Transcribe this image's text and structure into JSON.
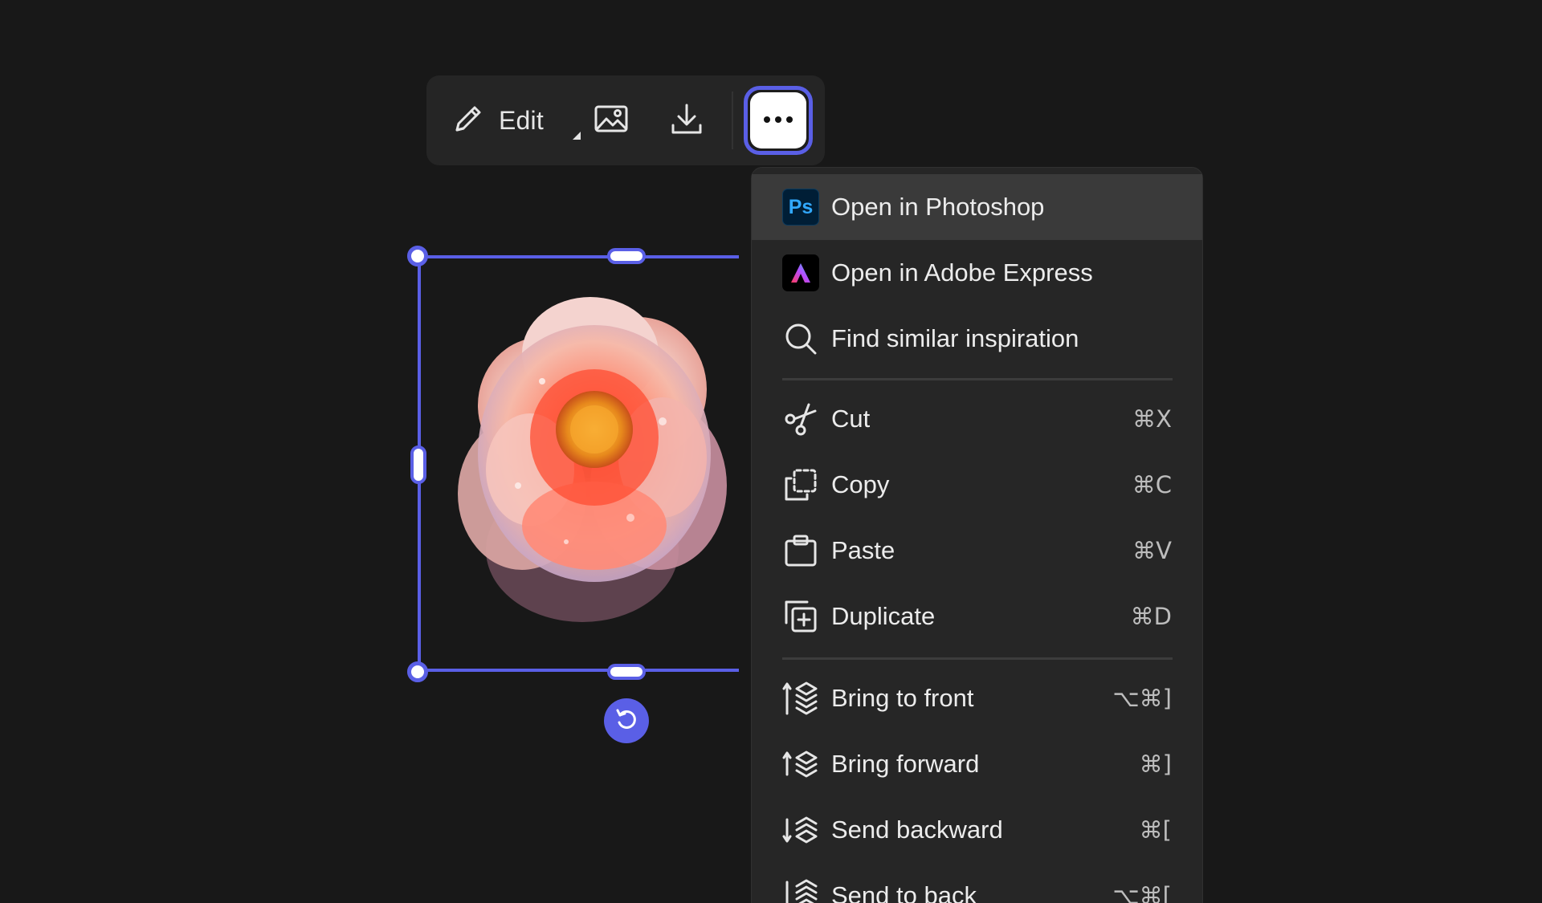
{
  "toolbar": {
    "edit_label": "Edit",
    "buttons": [
      {
        "name": "edit",
        "icon": "pencil-icon"
      },
      {
        "name": "image",
        "icon": "image-icon"
      },
      {
        "name": "download",
        "icon": "download-icon"
      },
      {
        "name": "more",
        "icon": "more-horizontal-icon"
      }
    ]
  },
  "canvas": {
    "selected_element": "flower-image",
    "accent_color": "#5a5fe6",
    "background_color": "#181818"
  },
  "menu": {
    "app_items": [
      {
        "label": "Open in Photoshop",
        "icon": "photoshop-icon",
        "badge": "Ps",
        "active": true
      },
      {
        "label": "Open in Adobe Express",
        "icon": "adobe-express-icon"
      },
      {
        "label": "Find similar inspiration",
        "icon": "search-icon"
      }
    ],
    "edit_items": [
      {
        "label": "Cut",
        "icon": "scissors-icon",
        "shortcut": "⌘X"
      },
      {
        "label": "Copy",
        "icon": "copy-icon",
        "shortcut": "⌘C"
      },
      {
        "label": "Paste",
        "icon": "paste-icon",
        "shortcut": "⌘V"
      },
      {
        "label": "Duplicate",
        "icon": "duplicate-icon",
        "shortcut": "⌘D"
      }
    ],
    "arrange_items": [
      {
        "label": "Bring to front",
        "icon": "bring-to-front-icon",
        "shortcut": "⌥⌘]"
      },
      {
        "label": "Bring forward",
        "icon": "bring-forward-icon",
        "shortcut": "⌘]"
      },
      {
        "label": "Send backward",
        "icon": "send-backward-icon",
        "shortcut": "⌘["
      },
      {
        "label": "Send to back",
        "icon": "send-to-back-icon",
        "shortcut": "⌥⌘["
      }
    ]
  }
}
